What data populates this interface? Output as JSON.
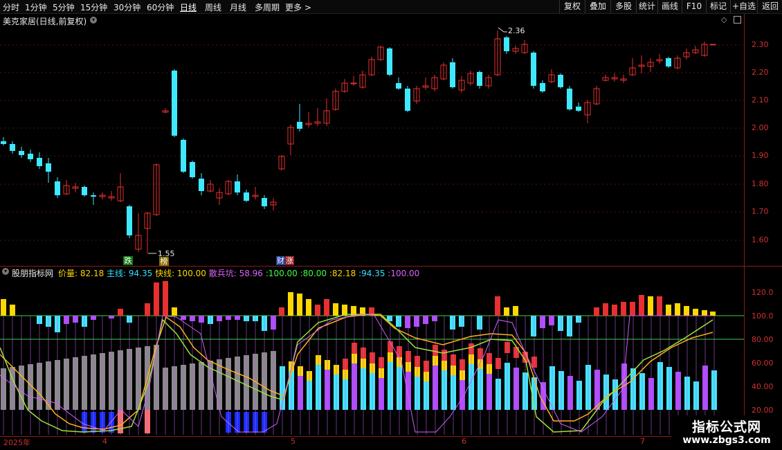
{
  "toolbar": {
    "left_tabs": [
      "分时",
      "1分钟",
      "5分钟",
      "15分钟",
      "30分钟",
      "60分钟",
      "日线",
      "周线",
      "月线",
      "多周期",
      "更多 >"
    ],
    "active_tab": "日线",
    "right_buttons": [
      "复权",
      "叠加",
      "多股",
      "统计",
      "画线",
      "F10",
      "标记",
      "+自选",
      "返回"
    ]
  },
  "main_chart": {
    "title": "美克家居(日线,前复权)",
    "y_ticks": [
      "2.30",
      "2.20",
      "2.10",
      "2.00",
      "1.90",
      "1.80",
      "1.70",
      "1.60"
    ],
    "high_label": "2.36",
    "low_label": "1.55",
    "markers": [
      {
        "text": "跌",
        "color": "#22aa22"
      },
      {
        "text": "榜",
        "color": "#c8a000"
      },
      {
        "text": "财",
        "color": "#2255cc"
      },
      {
        "text": "涨",
        "color": "#cc2222"
      }
    ]
  },
  "indicator": {
    "name": "股朋指标网",
    "values": [
      {
        "label": "价量:",
        "value": "82.18",
        "color": "#ffd700"
      },
      {
        "label": "主线:",
        "value": "94.35",
        "color": "#30e0ff"
      },
      {
        "label": "快线:",
        "value": "100.00",
        "color": "#ffd700"
      },
      {
        "label": "散兵坑:",
        "value": "58.96",
        "color": "#e060ff"
      },
      {
        "label": ":",
        "value": "100.00",
        "color": "#40ff40"
      },
      {
        "label": ":",
        "value": "80.00",
        "color": "#40ff40"
      },
      {
        "label": ":",
        "value": "82.18",
        "color": "#ffd700"
      },
      {
        "label": ":",
        "value": "94.35",
        "color": "#30e0ff"
      },
      {
        "label": ":",
        "value": "100.00",
        "color": "#e060ff"
      }
    ],
    "y_ticks": [
      "120.0",
      "100.0",
      "80.00",
      "60.00",
      "40.00",
      "20.00"
    ]
  },
  "date_axis": [
    "2025年",
    "4",
    "5",
    "6",
    "7"
  ],
  "watermark": {
    "line1": "指标公式网",
    "line2": "www.zbgs3.com"
  },
  "colors": {
    "up": "#e83030",
    "down": "#40e8ff",
    "axis": "#d23030",
    "bg": "#000000"
  }
}
